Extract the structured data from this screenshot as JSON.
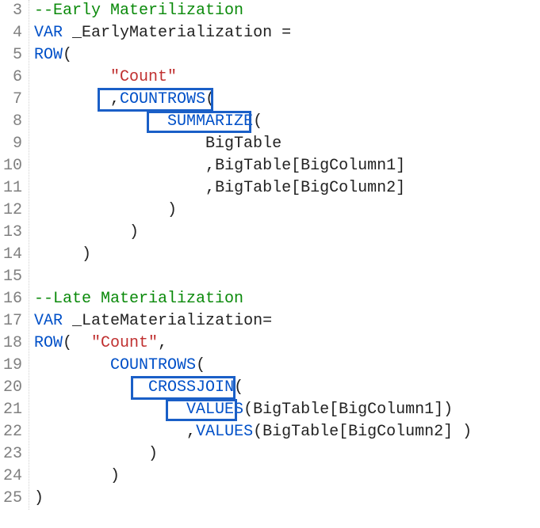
{
  "gutter": {
    "line3": "3",
    "line4": "4",
    "line5": "5",
    "line6": "6",
    "line7": "7",
    "line8": "8",
    "line9": "9",
    "line10": "10",
    "line11": "11",
    "line12": "12",
    "line13": "13",
    "line14": "14",
    "line15": "15",
    "line16": "16",
    "line17": "17",
    "line18": "18",
    "line19": "19",
    "line20": "20",
    "line21": "21",
    "line22": "22",
    "line23": "23",
    "line24": "24",
    "line25": "25"
  },
  "code": {
    "l3_comment": "--Early Materilization",
    "l4_var": "VAR",
    "l4_ident": " _EarlyMaterialization =",
    "l5_row": "ROW",
    "l5_paren": "(",
    "l6_indent": "        ",
    "l6_str": "\"Count\"",
    "l7_pre": "        ,",
    "l7_fn": "COUNTROWS",
    "l7_paren": "(",
    "l8_indent": "              ",
    "l8_fn": "SUMMARIZE",
    "l8_paren": "(",
    "l9_text": "                  BigTable",
    "l10_pre": "                  ,",
    "l10_ref": "BigTable[BigColumn1]",
    "l11_pre": "                  ,",
    "l11_ref": "BigTable[BigColumn2]",
    "l12_text": "              )",
    "l13_text": "          )",
    "l14_text": "     )",
    "l15_text": "",
    "l16_comment": "--Late Materialization",
    "l17_var": "VAR",
    "l17_ident": " _LateMaterialization=",
    "l18_row": "ROW",
    "l18_paren": "(  ",
    "l18_str": "\"Count\"",
    "l18_comma": ",",
    "l19_indent": "        ",
    "l19_fn": "COUNTROWS",
    "l19_paren": "(",
    "l20_indent": "            ",
    "l20_fn": "CROSSJOIN",
    "l20_paren": "(",
    "l21_indent": "                ",
    "l21_fn": "VALUES",
    "l21_paren": "(",
    "l21_ref": "BigTable[BigColumn1]",
    "l21_close": ")",
    "l22_pre": "                ,",
    "l22_fn": "VALUES",
    "l22_paren": "(",
    "l22_ref": "BigTable[BigColumn2]",
    "l22_close": " )",
    "l23_text": "            )",
    "l24_text": "        )",
    "l25_text": ")"
  }
}
